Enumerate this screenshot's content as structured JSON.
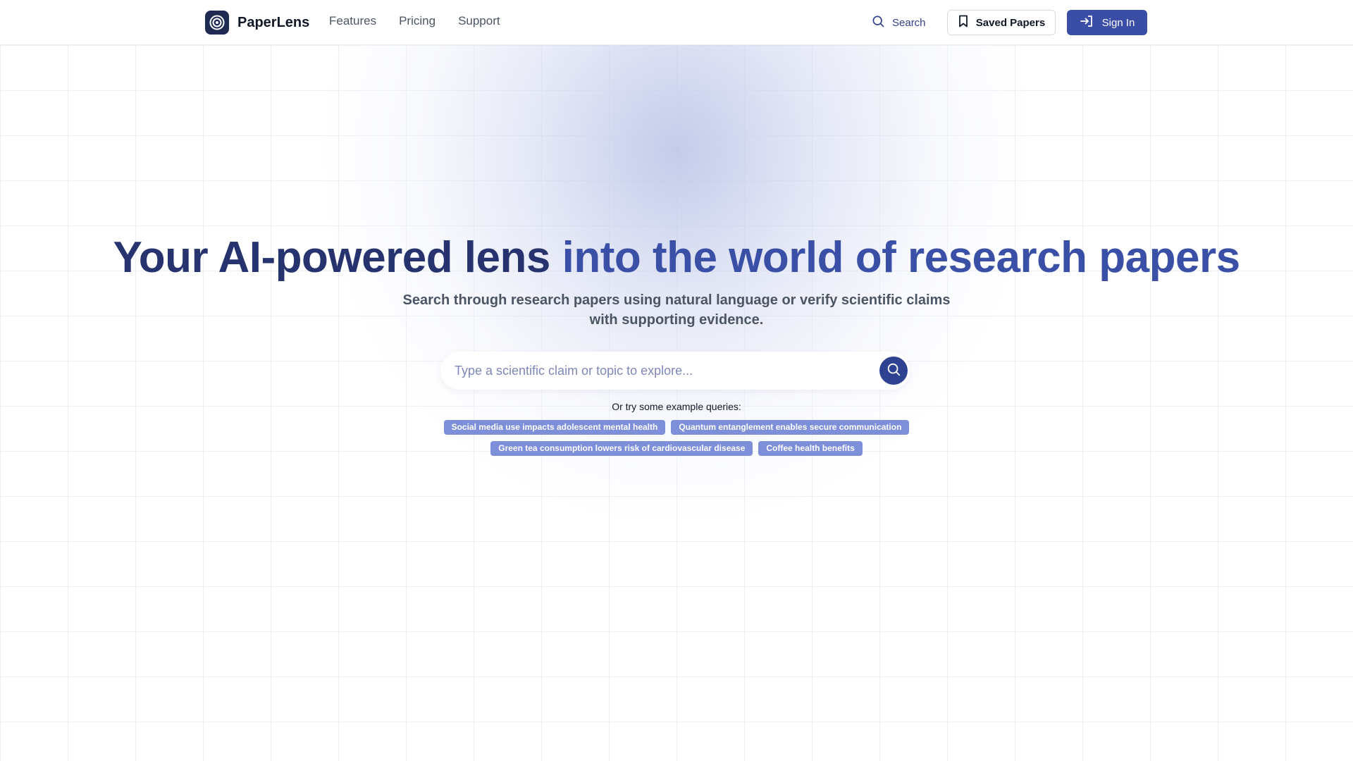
{
  "header": {
    "brand": "PaperLens",
    "nav": [
      "Features",
      "Pricing",
      "Support"
    ],
    "search_label": "Search",
    "saved_label": "Saved Papers",
    "signin_label": "Sign In"
  },
  "hero": {
    "title_part1": "Your AI-powered lens",
    "title_part2": "into the world of research papers",
    "subtitle": "Search through research papers using natural language or verify scientific claims with supporting evidence.",
    "search_placeholder": "Type a scientific claim or topic to explore...",
    "examples_label": "Or try some example queries:",
    "examples": [
      "Social media use impacts adolescent mental health",
      "Quantum entanglement enables secure communication",
      "Green tea consumption lowers risk of cardiovascular disease",
      "Coffee health benefits"
    ]
  },
  "colors": {
    "primary": "#3a4ea5",
    "primary_dark": "#26336e",
    "chip": "#7d8fd8"
  }
}
